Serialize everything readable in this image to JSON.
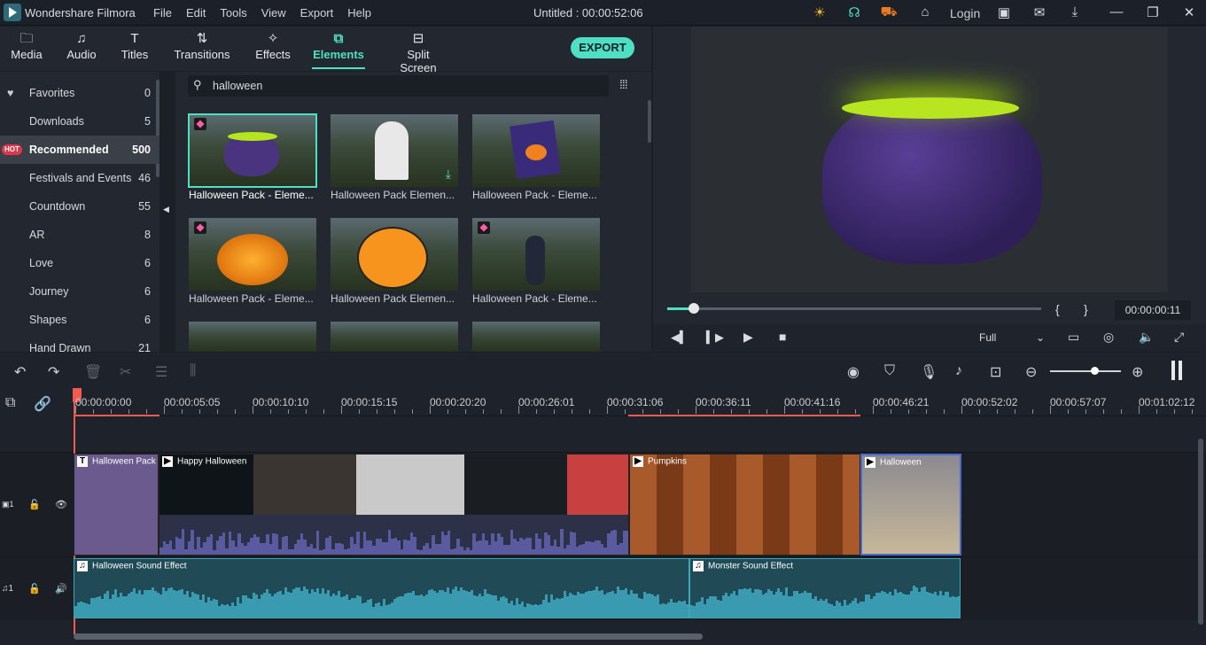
{
  "app": {
    "name": "Wondershare Filmora",
    "title": "Untitled : 00:00:52:06",
    "menu": [
      "File",
      "Edit",
      "Tools",
      "View",
      "Export",
      "Help"
    ],
    "login": "Login"
  },
  "tabs": [
    {
      "label": "Media",
      "icon": "folder-icon"
    },
    {
      "label": "Audio",
      "icon": "music-icon"
    },
    {
      "label": "Titles",
      "icon": "text-icon"
    },
    {
      "label": "Transitions",
      "icon": "transition-icon"
    },
    {
      "label": "Effects",
      "icon": "effects-icon"
    },
    {
      "label": "Elements",
      "icon": "elements-icon",
      "active": true
    },
    {
      "label": "Split Screen",
      "icon": "split-screen-icon"
    }
  ],
  "export_label": "EXPORT",
  "sidebar": {
    "items": [
      {
        "label": "Favorites",
        "count": "0"
      },
      {
        "label": "Downloads",
        "count": "5"
      },
      {
        "label": "Recommended",
        "count": "500",
        "badge": "HOT",
        "active": true
      },
      {
        "label": "Festivals and Events",
        "count": "46"
      },
      {
        "label": "Countdown",
        "count": "55"
      },
      {
        "label": "AR",
        "count": "8"
      },
      {
        "label": "Love",
        "count": "6"
      },
      {
        "label": "Journey",
        "count": "6"
      },
      {
        "label": "Shapes",
        "count": "6"
      },
      {
        "label": "Hand Drawn",
        "count": "21"
      }
    ]
  },
  "search": {
    "value": "halloween"
  },
  "elements": [
    {
      "caption": "Halloween Pack - Eleme...",
      "premium": true,
      "selected": true
    },
    {
      "caption": "Halloween Pack Elemen...",
      "download": true
    },
    {
      "caption": "Halloween Pack - Eleme..."
    },
    {
      "caption": "Halloween Pack - Eleme...",
      "premium": true
    },
    {
      "caption": "Halloween Pack Elemen..."
    },
    {
      "caption": "Halloween Pack - Eleme...",
      "premium": true
    }
  ],
  "preview": {
    "progress": 0.07,
    "timecode": "00:00:00:11",
    "quality": "Full",
    "brackets": [
      "{",
      "}"
    ]
  },
  "ruler": [
    "00:00:00:00",
    "00:00:05:05",
    "00:00:10:10",
    "00:00:15:15",
    "00:00:20:20",
    "00:00:26:01",
    "00:00:31:06",
    "00:00:36:11",
    "00:00:41:16",
    "00:00:46:21",
    "00:00:52:02",
    "00:00:57:07",
    "00:01:02:12"
  ],
  "tracks": {
    "video_label": "1",
    "audio_label": "1"
  },
  "video_clips": [
    {
      "label": "Halloween Pack",
      "type": "T",
      "color": "#6a5a8e"
    },
    {
      "label": "Happy Halloween",
      "type": "▶",
      "color": "#2a2c30"
    },
    {
      "label": "Pumpkins",
      "type": "▶",
      "color": "#8a4a24"
    },
    {
      "label": "Halloween",
      "type": "▶",
      "color": "#7a7a80"
    }
  ],
  "audio_clips": [
    {
      "label": "Halloween Sound Effect"
    },
    {
      "label": "Monster Sound Effect"
    }
  ],
  "colors": {
    "accent": "#4fe0c4",
    "playhead": "#f05a50",
    "audio": "#2a6c7c",
    "video_wave": "#5a5aa0"
  }
}
